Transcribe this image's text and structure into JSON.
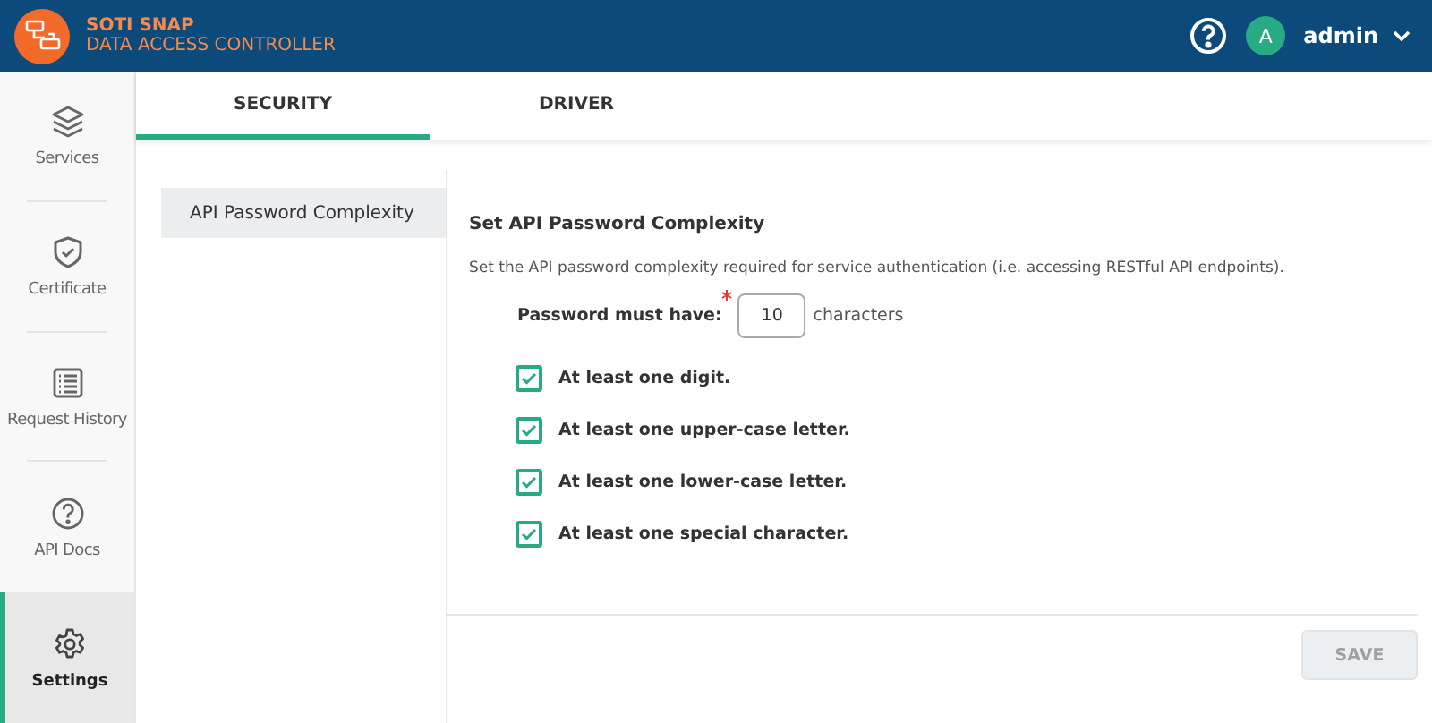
{
  "header": {
    "brand": "SOTI SNAP",
    "subtitle": "DATA ACCESS CONTROLLER",
    "user": {
      "initial": "A",
      "name": "admin"
    }
  },
  "sidebar": {
    "items": [
      {
        "label": "Services",
        "kind": "layers",
        "selected": false
      },
      {
        "label": "Certificate",
        "kind": "shield",
        "selected": false
      },
      {
        "label": "Request History",
        "kind": "list",
        "selected": false
      },
      {
        "label": "API Docs",
        "kind": "help",
        "selected": false
      },
      {
        "label": "Settings",
        "kind": "gear",
        "selected": true
      }
    ]
  },
  "tabs": [
    {
      "label": "SECURITY",
      "selected": true
    },
    {
      "label": "DRIVER",
      "selected": false
    }
  ],
  "subnav": [
    {
      "label": "API Password Complexity",
      "selected": true
    }
  ],
  "panel": {
    "title": "Set API Password Complexity",
    "description": "Set the API password complexity required for service authentication (i.e. accessing RESTful API endpoints).",
    "length": {
      "label": "Password must have:",
      "required": true,
      "value": "10",
      "unit": "characters"
    },
    "options": [
      {
        "label": "At least one digit.",
        "checked": true
      },
      {
        "label": "At least one upper-case letter.",
        "checked": true
      },
      {
        "label": "At least one lower-case letter.",
        "checked": true
      },
      {
        "label": "At least one special character.",
        "checked": true
      }
    ],
    "save": {
      "label": "SAVE",
      "disabled": true
    }
  }
}
